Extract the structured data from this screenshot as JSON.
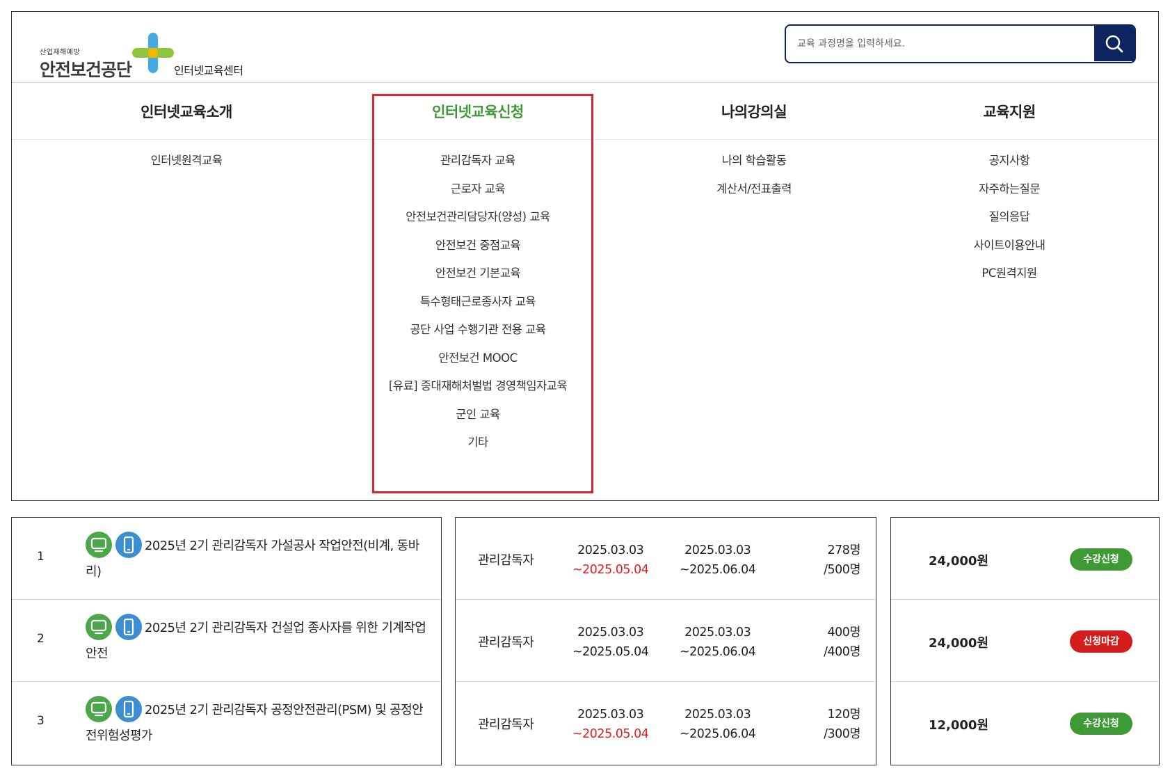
{
  "header": {
    "logo_sub": "산업재해예방",
    "logo_main": "안전보건공단",
    "logo_center": "인터넷교육센터",
    "search_placeholder": "교육 과정명을 입력하세요."
  },
  "nav": {
    "menus": [
      {
        "title": "인터넷교육소개",
        "items": [
          "인터넷원격교육"
        ]
      },
      {
        "title": "인터넷교육신청",
        "items": [
          "관리감독자 교육",
          "근로자 교육",
          "안전보건관리담당자(양성) 교육",
          "안전보건 중점교육",
          "안전보건 기본교육",
          "특수형태근로종사자 교육",
          "공단 사업 수행기관 전용 교육",
          "안전보건 MOOC",
          "[유료] 중대재해처벌법 경영책임자교육",
          "군인 교육",
          "기타"
        ]
      },
      {
        "title": "나의강의실",
        "items": [
          "나의 학습활동",
          "계산서/전표출력"
        ]
      },
      {
        "title": "교육지원",
        "items": [
          "공지사항",
          "자주하는질문",
          "질의응답",
          "사이트이용안내",
          "PC원격지원"
        ]
      }
    ]
  },
  "courses": [
    {
      "no": "1",
      "name": "2025년 2기 관리감독자 가설공사 작업안전(비계, 동바리)",
      "target": "관리감독자",
      "recv_start": "2025.03.03",
      "recv_end": "~2025.05.04",
      "study_start": "2025.03.03",
      "study_end": "~2025.06.04",
      "applied": "278명",
      "capacity": "/500명",
      "price": "24,000원",
      "status": "수강신청"
    },
    {
      "no": "2",
      "name": "2025년 2기 관리감독자 건설업 종사자를 위한 기계작업 안전",
      "target": "관리감독자",
      "recv_start": "2025.03.03",
      "recv_end": "~2025.05.04",
      "study_start": "2025.03.03",
      "study_end": "~2025.06.04",
      "applied": "400명",
      "capacity": "/400명",
      "price": "24,000원",
      "status": "신청마감"
    },
    {
      "no": "3",
      "name": "2025년 2기 관리감독자 공정안전관리(PSM) 및 공정안전위험성평가",
      "target": "관리감독자",
      "recv_start": "2025.03.03",
      "recv_end": "~2025.05.04",
      "study_start": "2025.03.03",
      "study_end": "~2025.06.04",
      "applied": "120명",
      "capacity": "/300명",
      "price": "12,000원",
      "status": "수강신청"
    }
  ],
  "colors": {
    "brand_navy": "#0e2460",
    "active_green": "#3e9a35",
    "highlight_red": "#d9262c",
    "pc_icon_green": "#4ca64a",
    "mobile_icon_blue": "#3b8fd0",
    "closed_red": "#d41e1e",
    "date_red": "#e0201b"
  },
  "icons": {
    "search": "magnifier-icon",
    "pc": "monitor-icon",
    "mobile": "smartphone-icon"
  }
}
